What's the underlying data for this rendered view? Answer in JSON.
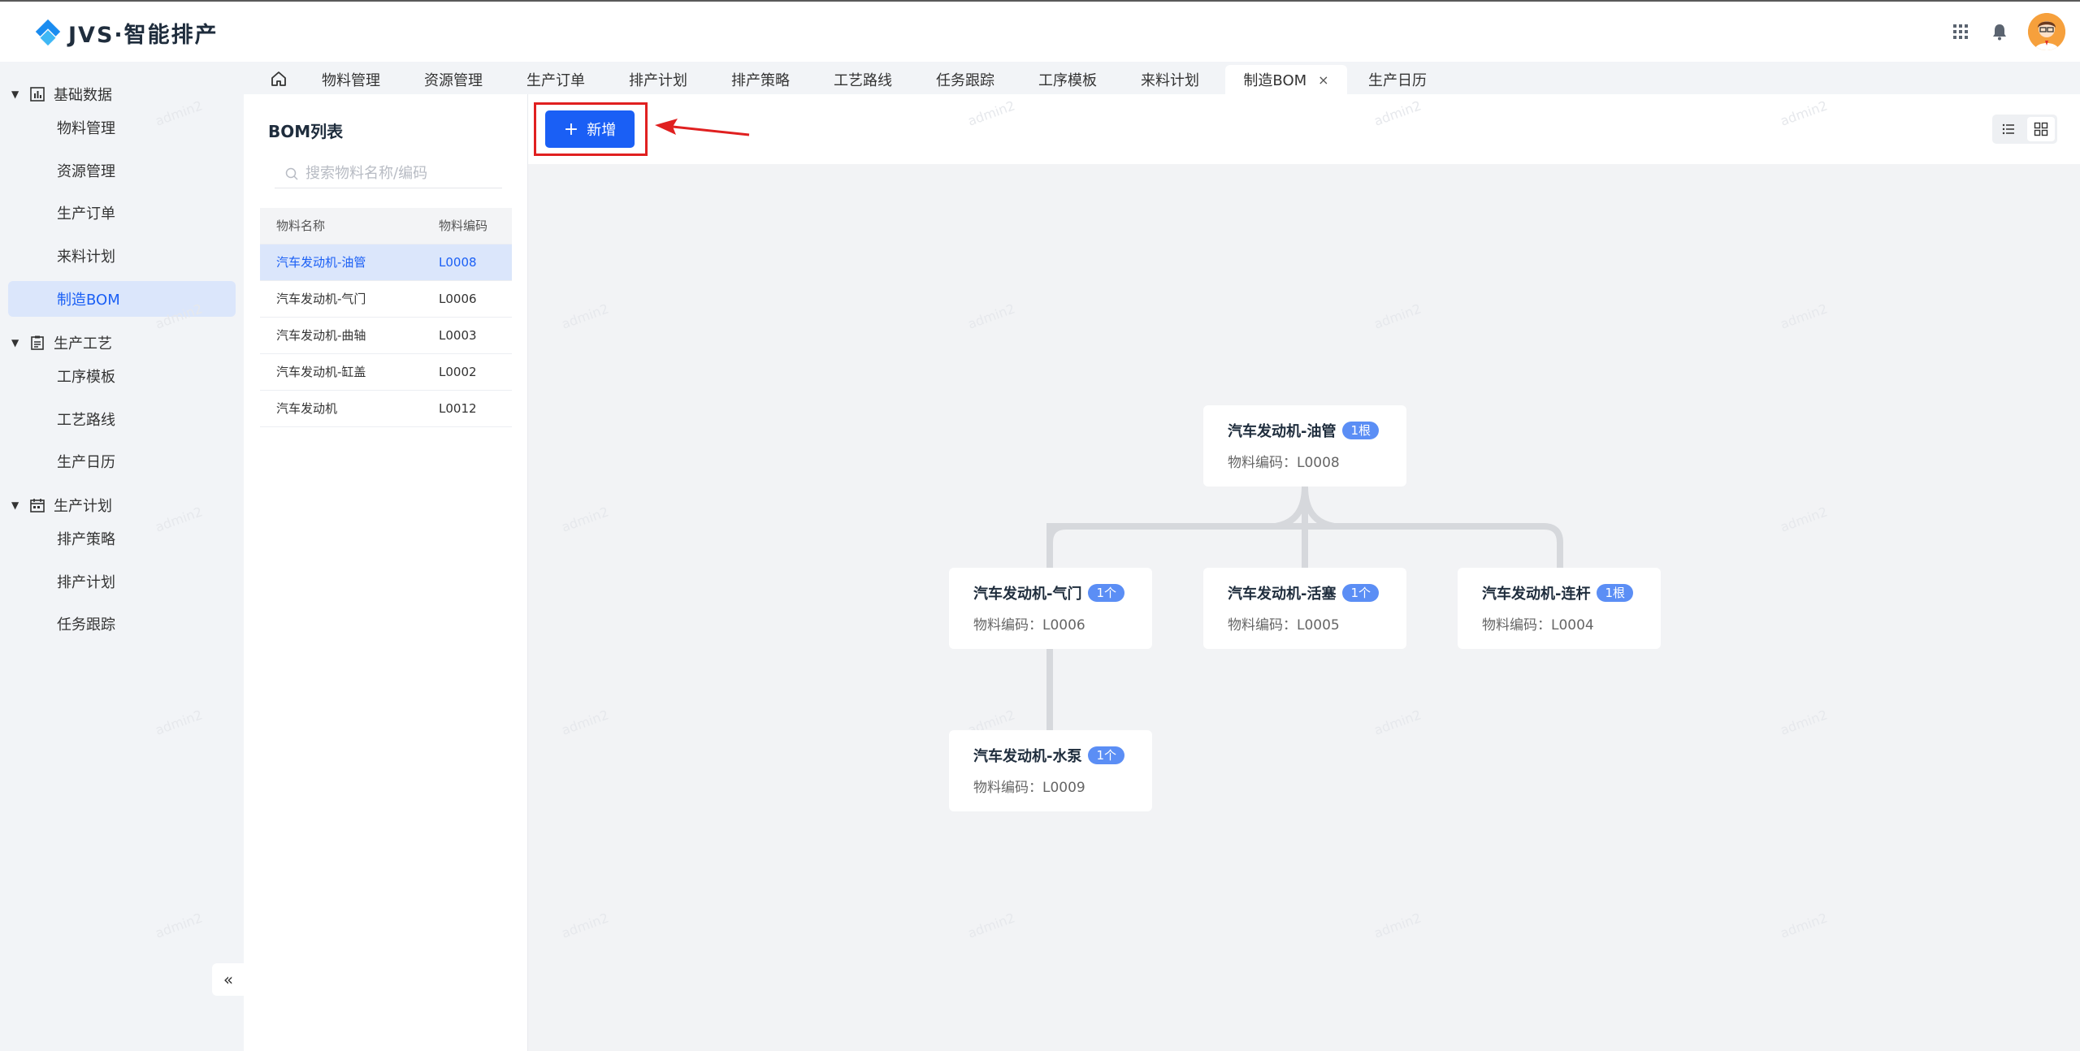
{
  "app": {
    "logo_text": "JVS·智能排产"
  },
  "sidebar": {
    "groups": [
      {
        "label": "基础数据",
        "icon": "bar-chart-icon",
        "items": [
          "物料管理",
          "资源管理",
          "生产订单",
          "来料计划",
          "制造BOM"
        ]
      },
      {
        "label": "生产工艺",
        "icon": "clipboard-icon",
        "items": [
          "工序模板",
          "工艺路线",
          "生产日历"
        ]
      },
      {
        "label": "生产计划",
        "icon": "calendar-icon",
        "items": [
          "排产策略",
          "排产计划",
          "任务跟踪"
        ]
      }
    ],
    "active_item": "制造BOM",
    "collapse_label": "«"
  },
  "tabs": [
    {
      "label": "物料管理"
    },
    {
      "label": "资源管理"
    },
    {
      "label": "生产订单"
    },
    {
      "label": "排产计划"
    },
    {
      "label": "排产策略"
    },
    {
      "label": "工艺路线"
    },
    {
      "label": "任务跟踪"
    },
    {
      "label": "工序模板"
    },
    {
      "label": "来料计划"
    },
    {
      "label": "制造BOM",
      "active": true,
      "close": "×"
    },
    {
      "label": "生产日历"
    }
  ],
  "bom_panel": {
    "title": "BOM列表",
    "search_placeholder": "搜索物料名称/编码",
    "columns": [
      "物料名称",
      "物料编码"
    ],
    "rows": [
      {
        "name": "汽车发动机-油管",
        "code": "L0008",
        "selected": true
      },
      {
        "name": "汽车发动机-气门",
        "code": "L0006"
      },
      {
        "name": "汽车发动机-曲轴",
        "code": "L0003"
      },
      {
        "name": "汽车发动机-缸盖",
        "code": "L0002"
      },
      {
        "name": "汽车发动机",
        "code": "L0012"
      }
    ]
  },
  "toolbar": {
    "add_label": "新增",
    "add_icon": "+"
  },
  "tree": {
    "code_label": "物料编码：",
    "nodes": {
      "root": {
        "name": "汽车发动机-油管",
        "badge": "1根",
        "code": "L0008"
      },
      "valve": {
        "name": "汽车发动机-气门",
        "badge": "1个",
        "code": "L0006"
      },
      "piston": {
        "name": "汽车发动机-活塞",
        "badge": "1个",
        "code": "L0005"
      },
      "rod": {
        "name": "汽车发动机-连杆",
        "badge": "1根",
        "code": "L0004"
      },
      "pump": {
        "name": "汽车发动机-水泵",
        "badge": "1个",
        "code": "L0009"
      }
    }
  },
  "watermark_text": "admin2",
  "colors": {
    "primary": "#1a5ff5",
    "highlight_border": "#e02020",
    "badge": "#5b8ef5",
    "selected_bg": "#dbe6fb"
  }
}
